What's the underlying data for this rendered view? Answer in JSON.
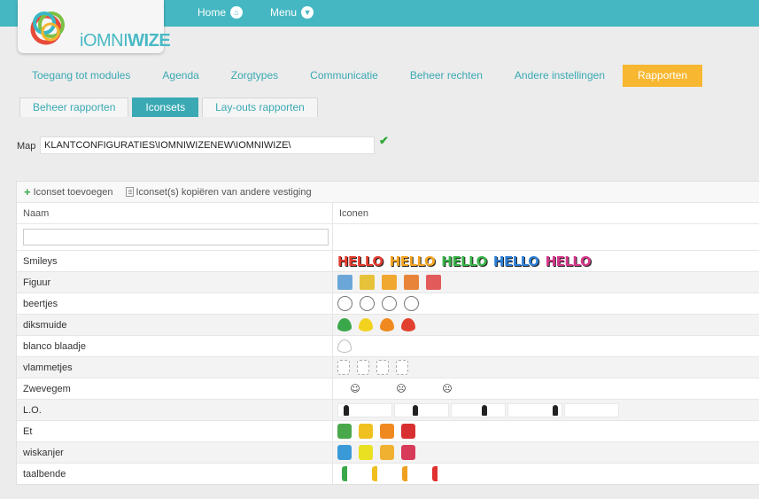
{
  "header": {
    "logo_prefix": "i",
    "logo_omni": "OMNI",
    "logo_wize": "WIZE",
    "home_label": "Home",
    "menu_label": "Menu"
  },
  "main_tabs": [
    "Toegang tot modules",
    "Agenda",
    "Zorgtypes",
    "Communicatie",
    "Beheer rechten",
    "Andere instellingen",
    "Rapporten"
  ],
  "sub_tabs": [
    "Beheer rapporten",
    "Iconsets",
    "Lay-outs rapporten"
  ],
  "map": {
    "label": "Map",
    "value": "KLANTCONFIGURATIES\\IOMNIWIZENEW\\IOMNIWIZE\\"
  },
  "toolbar": {
    "add_label": "Iconset toevoegen",
    "copy_label": "Iconset(s) kopiëren van andere vestiging"
  },
  "table": {
    "col_name": "Naam",
    "col_icons": "Iconen",
    "hello_text": "HELLO",
    "rows": [
      "Smileys",
      "Figuur",
      "beertjes",
      "diksmuide",
      "blanco blaadje",
      "vlammetjes",
      "Zwevegem",
      "L.O.",
      "Et",
      "wiskanjer",
      "taalbende"
    ]
  },
  "colors": {
    "accent": "#45b7c2",
    "active_tab": "#f8b730"
  }
}
